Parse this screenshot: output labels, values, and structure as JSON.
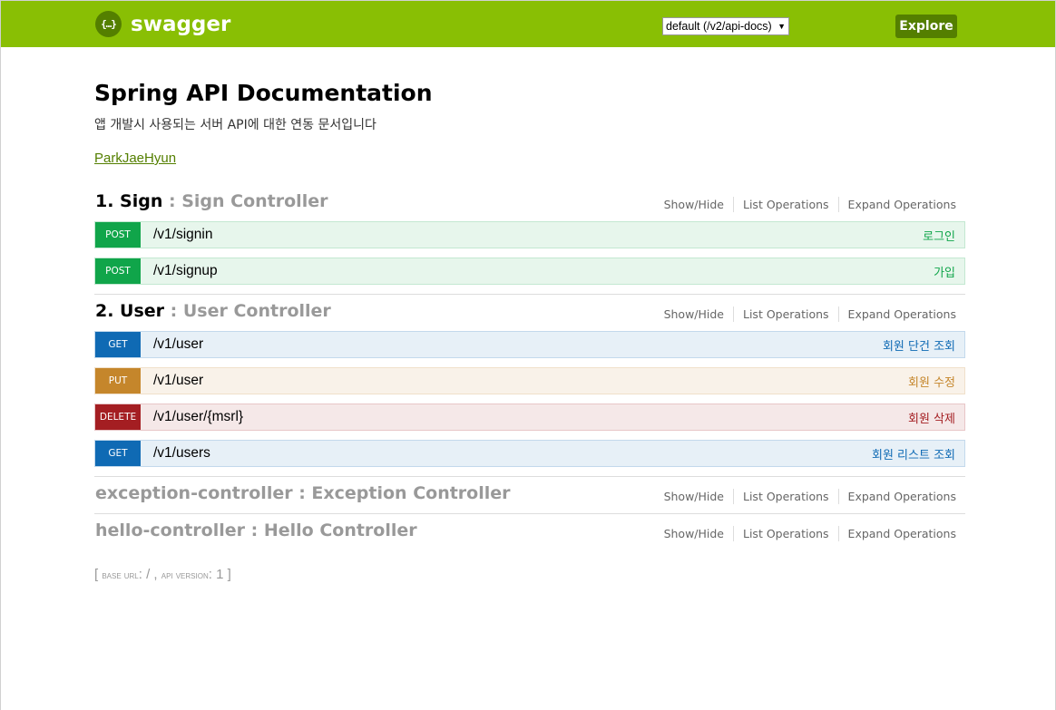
{
  "header": {
    "logo_mark": "{…}",
    "logo_text": "swagger",
    "api_select_value": "default (/v2/api-docs)",
    "explore_label": "Explore",
    "colors": {
      "bar": "#89bf04",
      "dark": "#547f00"
    }
  },
  "info": {
    "title": "Spring API Documentation",
    "description": "앱 개발시 사용되는 서버 API에 대한 연동 문서입니다",
    "author": "ParkJaeHyun"
  },
  "resource_links": {
    "show_hide": "Show/Hide",
    "list": "List Operations",
    "expand": "Expand Operations"
  },
  "resources": [
    {
      "name": "1. Sign",
      "desc": " : Sign Controller",
      "operations": [
        {
          "method": "POST",
          "path": "/v1/signin",
          "summary": "로그인"
        },
        {
          "method": "POST",
          "path": "/v1/signup",
          "summary": "가입"
        }
      ]
    },
    {
      "name": "2. User",
      "desc": " : User Controller",
      "operations": [
        {
          "method": "GET",
          "path": "/v1/user",
          "summary": "회원 단건 조회"
        },
        {
          "method": "PUT",
          "path": "/v1/user",
          "summary": "회원 수정"
        },
        {
          "method": "DELETE",
          "path": "/v1/user/{msrl}",
          "summary": "회원 삭제"
        },
        {
          "method": "GET",
          "path": "/v1/users",
          "summary": "회원 리스트 조회"
        }
      ]
    },
    {
      "name": "exception-controller",
      "desc": " : Exception Controller",
      "operations": []
    },
    {
      "name": "hello-controller",
      "desc": " : Hello Controller",
      "operations": []
    }
  ],
  "footer": {
    "open": "[ ",
    "base_url_label": "base url",
    "base_url_value": ": / , ",
    "api_version_label": "api version",
    "api_version_value": ": 1 ]"
  }
}
